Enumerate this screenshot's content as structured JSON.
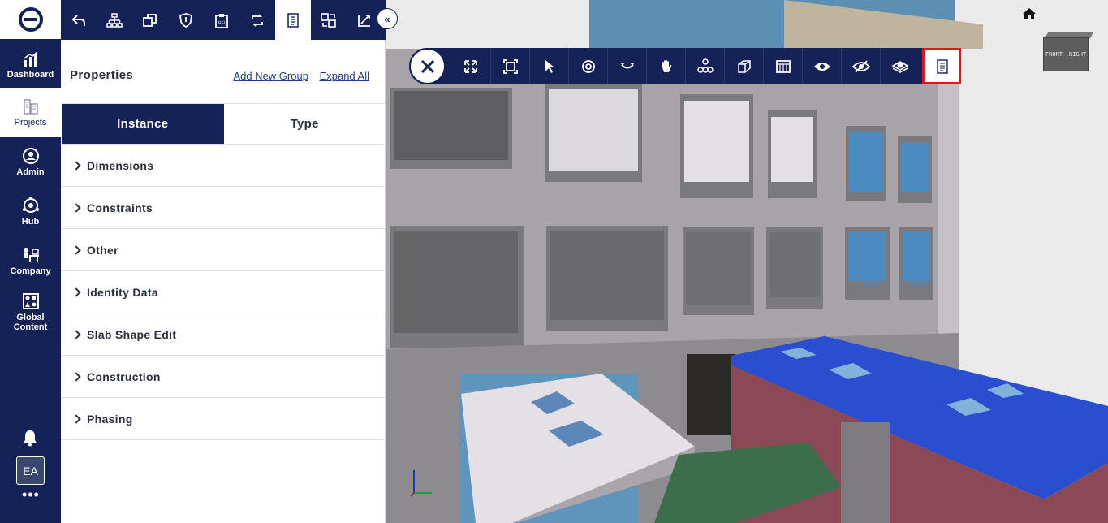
{
  "leftnav": {
    "items": [
      {
        "label": "Dashboard",
        "icon": "chart-icon"
      },
      {
        "label": "Projects",
        "icon": "buildings-icon"
      },
      {
        "label": "Admin",
        "icon": "admin-icon"
      },
      {
        "label": "Hub",
        "icon": "hub-icon"
      },
      {
        "label": "Company",
        "icon": "company-icon"
      },
      {
        "label": "Global Content",
        "icon": "global-content-icon"
      }
    ],
    "avatar": "EA",
    "more": "•••"
  },
  "panel": {
    "title": "Properties",
    "add_group": "Add New Group",
    "expand_all": "Expand All",
    "tabs": [
      "Instance",
      "Type"
    ],
    "groups": [
      "Dimensions",
      "Constraints",
      "Other",
      "Identity Data",
      "Slab Shape Edit",
      "Construction",
      "Phasing"
    ],
    "collapse": "«"
  },
  "viewcube": {
    "front": "FRONT",
    "right": "RIGHT"
  },
  "colors": {
    "navy": "#142257",
    "highlight": "#e0161c"
  }
}
